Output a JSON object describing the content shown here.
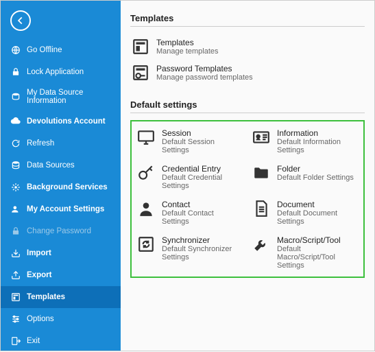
{
  "sidebar": {
    "items": [
      {
        "label": "Go Offline"
      },
      {
        "label": "Lock Application"
      },
      {
        "label": "My Data Source Information"
      },
      {
        "label": "Devolutions Account"
      },
      {
        "label": "Refresh"
      },
      {
        "label": "Data Sources"
      },
      {
        "label": "Background Services"
      },
      {
        "label": "My Account Settings"
      },
      {
        "label": "Change Password"
      },
      {
        "label": "Import"
      },
      {
        "label": "Export"
      },
      {
        "label": "Templates"
      },
      {
        "label": "Options"
      },
      {
        "label": "Exit"
      }
    ]
  },
  "templates_section": {
    "title": "Templates",
    "items": [
      {
        "title": "Templates",
        "sub": "Manage templates"
      },
      {
        "title": "Password Templates",
        "sub": "Manage password templates"
      }
    ]
  },
  "default_section": {
    "title": "Default settings",
    "items": [
      {
        "title": "Session",
        "sub": "Default Session Settings"
      },
      {
        "title": "Information",
        "sub": "Default Information Settings"
      },
      {
        "title": "Credential Entry",
        "sub": "Default Credential Settings"
      },
      {
        "title": "Folder",
        "sub": "Default Folder Settings"
      },
      {
        "title": "Contact",
        "sub": "Default Contact Settings"
      },
      {
        "title": "Document",
        "sub": "Default Document Settings"
      },
      {
        "title": "Synchronizer",
        "sub": "Default Synchronizer Settings"
      },
      {
        "title": "Macro/Script/Tool",
        "sub": "Default Macro/Script/Tool Settings"
      }
    ]
  }
}
